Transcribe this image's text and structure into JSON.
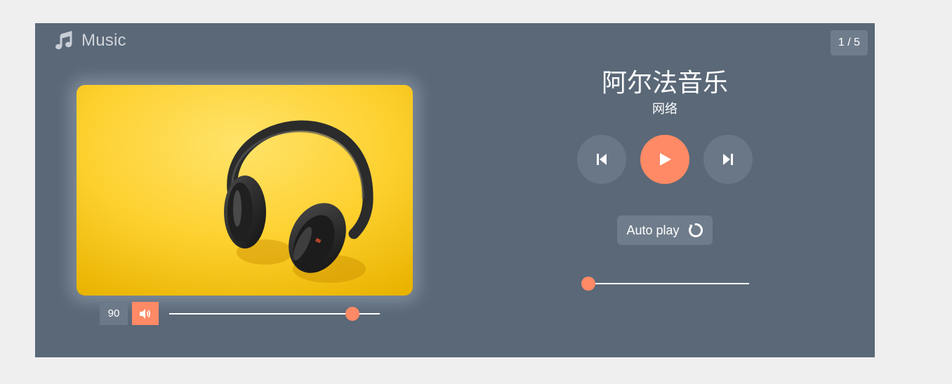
{
  "app": {
    "title": "Music",
    "icon": "music-note-icon",
    "counter": "1 / 5"
  },
  "song": {
    "title": "阿尔法音乐",
    "artist": "网络",
    "cover_icon": "headphones-image"
  },
  "volume": {
    "value": "90",
    "level_fraction": 0.87,
    "mute_icon": "speaker-volume-icon"
  },
  "controls": {
    "prev_icon": "skip-previous-icon",
    "play_icon": "play-icon",
    "next_icon": "skip-next-icon"
  },
  "autoplay": {
    "label": "Auto play",
    "icon": "loop-icon"
  },
  "progress": {
    "fraction": 0.0
  },
  "colors": {
    "background": "#efefef",
    "panel": "#5a6878",
    "accent": "#ff8a65",
    "button": "#6a7787",
    "cover_yellow": "#fdd33c"
  }
}
